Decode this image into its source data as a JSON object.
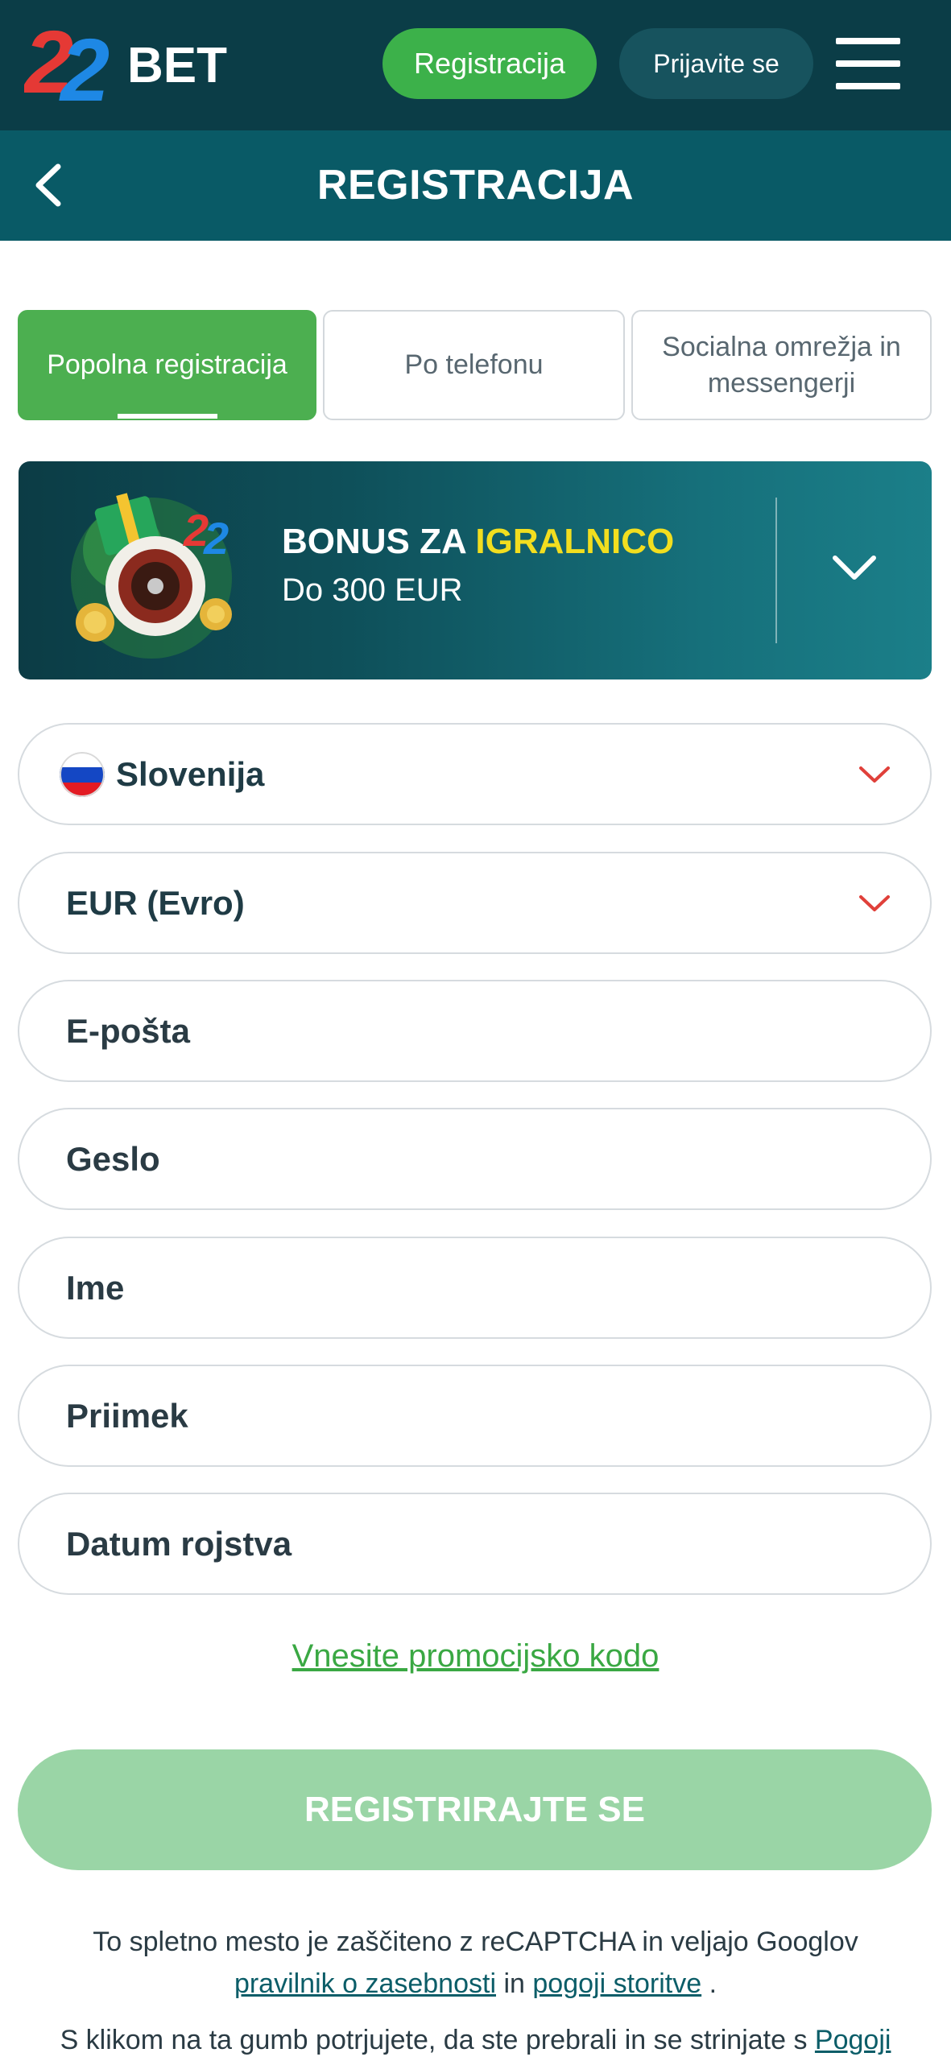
{
  "topbar": {
    "logo_text": "22BET",
    "register_label": "Registracija",
    "login_label": "Prijavite se"
  },
  "header": {
    "title": "REGISTRACIJA"
  },
  "tabs": [
    {
      "label": "Popolna registracija",
      "active": true
    },
    {
      "label": "Po telefonu",
      "active": false
    },
    {
      "label": "Socialna omrežja in messengerji",
      "active": false
    }
  ],
  "bonus": {
    "title_prefix": "BONUS ZA ",
    "title_highlight": "IGRALNICO",
    "subtitle": "Do 300 EUR"
  },
  "form": {
    "country": "Slovenija",
    "currency": "EUR (Evro)",
    "email_placeholder": "E-pošta",
    "password_placeholder": "Geslo",
    "first_name_placeholder": "Ime",
    "last_name_placeholder": "Priimek",
    "birthdate_placeholder": "Datum rojstva"
  },
  "promo_link": "Vnesite promocijsko kodo",
  "submit_label": "REGISTRIRAJTE SE",
  "legal": {
    "recaptcha_text": "To spletno mesto je zaščiteno z reCAPTCHA in veljajo Googlov",
    "privacy_link": "pravilnik o zasebnosti",
    "and": "in",
    "terms_link": "pogoji storitve",
    "period": ".",
    "consent_text": "S klikom na ta gumb potrjujete, da ste prebrali in se strinjate s",
    "consent_link": "Pogoji"
  },
  "colors": {
    "topbar_bg": "#0b3d47",
    "header_bg": "#095a66",
    "accent_green": "#3cb14a",
    "highlight_yellow": "#f2de1f",
    "chevron_red": "#e0403a"
  }
}
